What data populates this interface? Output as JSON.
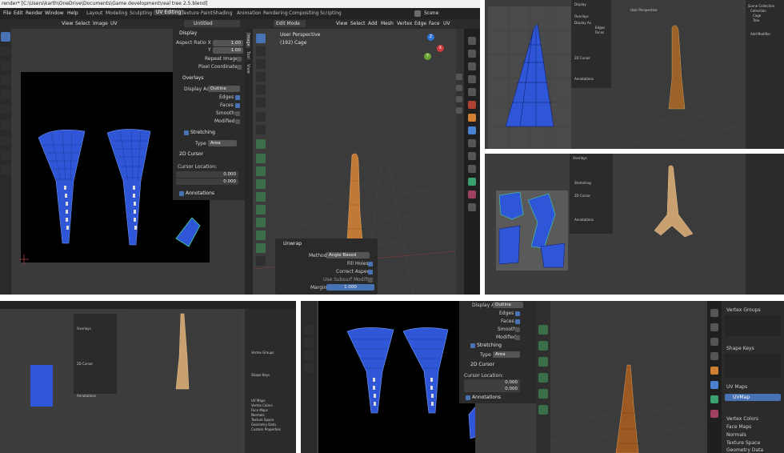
{
  "topbar": {
    "title": "render* [C:\\Users\\karth\\OneDrive\\Documents\\Game development\\real tree 2.5.blend]",
    "menus": [
      "File",
      "Edit",
      "Render",
      "Window",
      "Help"
    ],
    "workspaces": [
      "Layout",
      "Modeling",
      "Sculpting",
      "UV Editing",
      "Texture Paint",
      "Shading",
      "Animation",
      "Rendering",
      "Compositing",
      "Scripting"
    ],
    "active_workspace": "UV Editing",
    "scene": "Scene"
  },
  "uv_editor": {
    "menus": [
      "View",
      "Select",
      "Image",
      "UV"
    ],
    "image_name": "Untitled",
    "display": {
      "header": "Display",
      "aspect_ratio_label": "Aspect Ratio X",
      "aspect_x": "1.00",
      "y_label": "Y",
      "aspect_y": "1.00",
      "repeat_image": "Repeat Image",
      "pixel_coordinates": "Pixel Coordinates"
    },
    "overlays": {
      "header": "Overlays",
      "display_as_label": "Display As",
      "display_as": "Outline",
      "edges": "Edges",
      "faces": "Faces",
      "smooth": "Smooth",
      "modified": "Modified",
      "stretching": "Stretching",
      "type_label": "Type",
      "type": "Area"
    },
    "cursor": {
      "header": "2D Cursor",
      "location_label": "Cursor Location:",
      "x_label": "X:",
      "x": "0.000",
      "y_label": "Y:",
      "y": "0.000"
    },
    "annotations": "Annotations",
    "side_tabs": [
      "Image",
      "Tool",
      "View"
    ]
  },
  "viewport": {
    "mode": "Edit Mode",
    "menus": [
      "View",
      "Select",
      "Add",
      "Mesh",
      "Vertex",
      "Edge",
      "Face",
      "UV"
    ],
    "perspective": "User Perspective",
    "object": "(192) Cage",
    "gizmo_axes": [
      "X",
      "Y",
      "Z"
    ]
  },
  "unwrap_panel": {
    "header": "Unwrap",
    "method_label": "Method",
    "method": "Angle Based",
    "fill_holes": "Fill Holes",
    "correct_aspect": "Correct Aspect",
    "use_subsurf": "Use Subsurf Modifier",
    "margin_label": "Margin",
    "margin": "1.000"
  },
  "properties_tr": {
    "items": [
      "Scene Collection",
      "Collection",
      "Cage",
      "Tree",
      "Add Modifier"
    ]
  },
  "properties_bl": {
    "items": [
      "Vertex Groups",
      "Shape Keys",
      "UV Maps",
      "Vertex Colors",
      "Face Maps",
      "Normals",
      "Texture Space",
      "Geometry Data",
      "Custom Properties"
    ]
  },
  "properties_br": {
    "vertex_groups": "Vertex Groups",
    "shape_keys": "Shape Keys",
    "uv_maps": "UV Maps",
    "uvmap_name": "UVMap",
    "vertex_colors": "Vertex Colors",
    "face_maps": "Face Maps",
    "normals": "Normals",
    "texture_space": "Texture Space",
    "geometry_data": "Geometry Data"
  },
  "br_overlay": {
    "display_as_label": "Display As",
    "display_as": "Outline",
    "edges": "Edges",
    "faces": "Faces",
    "smooth": "Smooth",
    "modified": "Modified",
    "stretching": "Stretching",
    "type_label": "Type",
    "type": "Area",
    "cursor_header": "2D Cursor",
    "cursor_location": "Cursor Location:",
    "x_label": "X",
    "x": "0.000",
    "y_label": "Y",
    "y": "0.000",
    "annotations": "Annotations"
  },
  "colors": {
    "uv_blue": "#2f56d6",
    "accent": "#4772b3",
    "wood": "#c07a35",
    "green": "#6a9955"
  }
}
